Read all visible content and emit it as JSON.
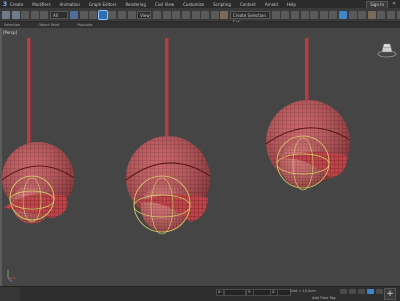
{
  "menu": {
    "items": [
      "Create",
      "Modifiers",
      "Animation",
      "Graph Editors",
      "Rendering",
      "Civil View",
      "Customize",
      "Scripting",
      "Content",
      "Arnold",
      "Help"
    ],
    "sign_in": "Sign In",
    "close_icon": "close-icon"
  },
  "toolbar": {
    "selection_filter": "All",
    "named_selection": "Create Selection Set",
    "view_dropdown": "View"
  },
  "subbar": {
    "labels": [
      "Selection",
      "Object Paint",
      "Populate"
    ]
  },
  "viewport": {
    "label": "[+] [Perspective] [User Defined] [Default Shading]",
    "label_short": "[Persp]"
  },
  "statusbar": {
    "x_label": "X:",
    "x_value": "",
    "y_label": "Y:",
    "y_value": "",
    "z_label": "Z:",
    "z_value": "",
    "grid": "Grid = 10,0cm",
    "add_time_tag": "Add Time Tag",
    "plus": "+"
  },
  "colors": {
    "accent": "#3f86c8",
    "object_red": "#c0444a",
    "wire_dark": "#5a1414",
    "gizmo_yellow": "#d8d26a",
    "viewport_bg": "#454545"
  }
}
